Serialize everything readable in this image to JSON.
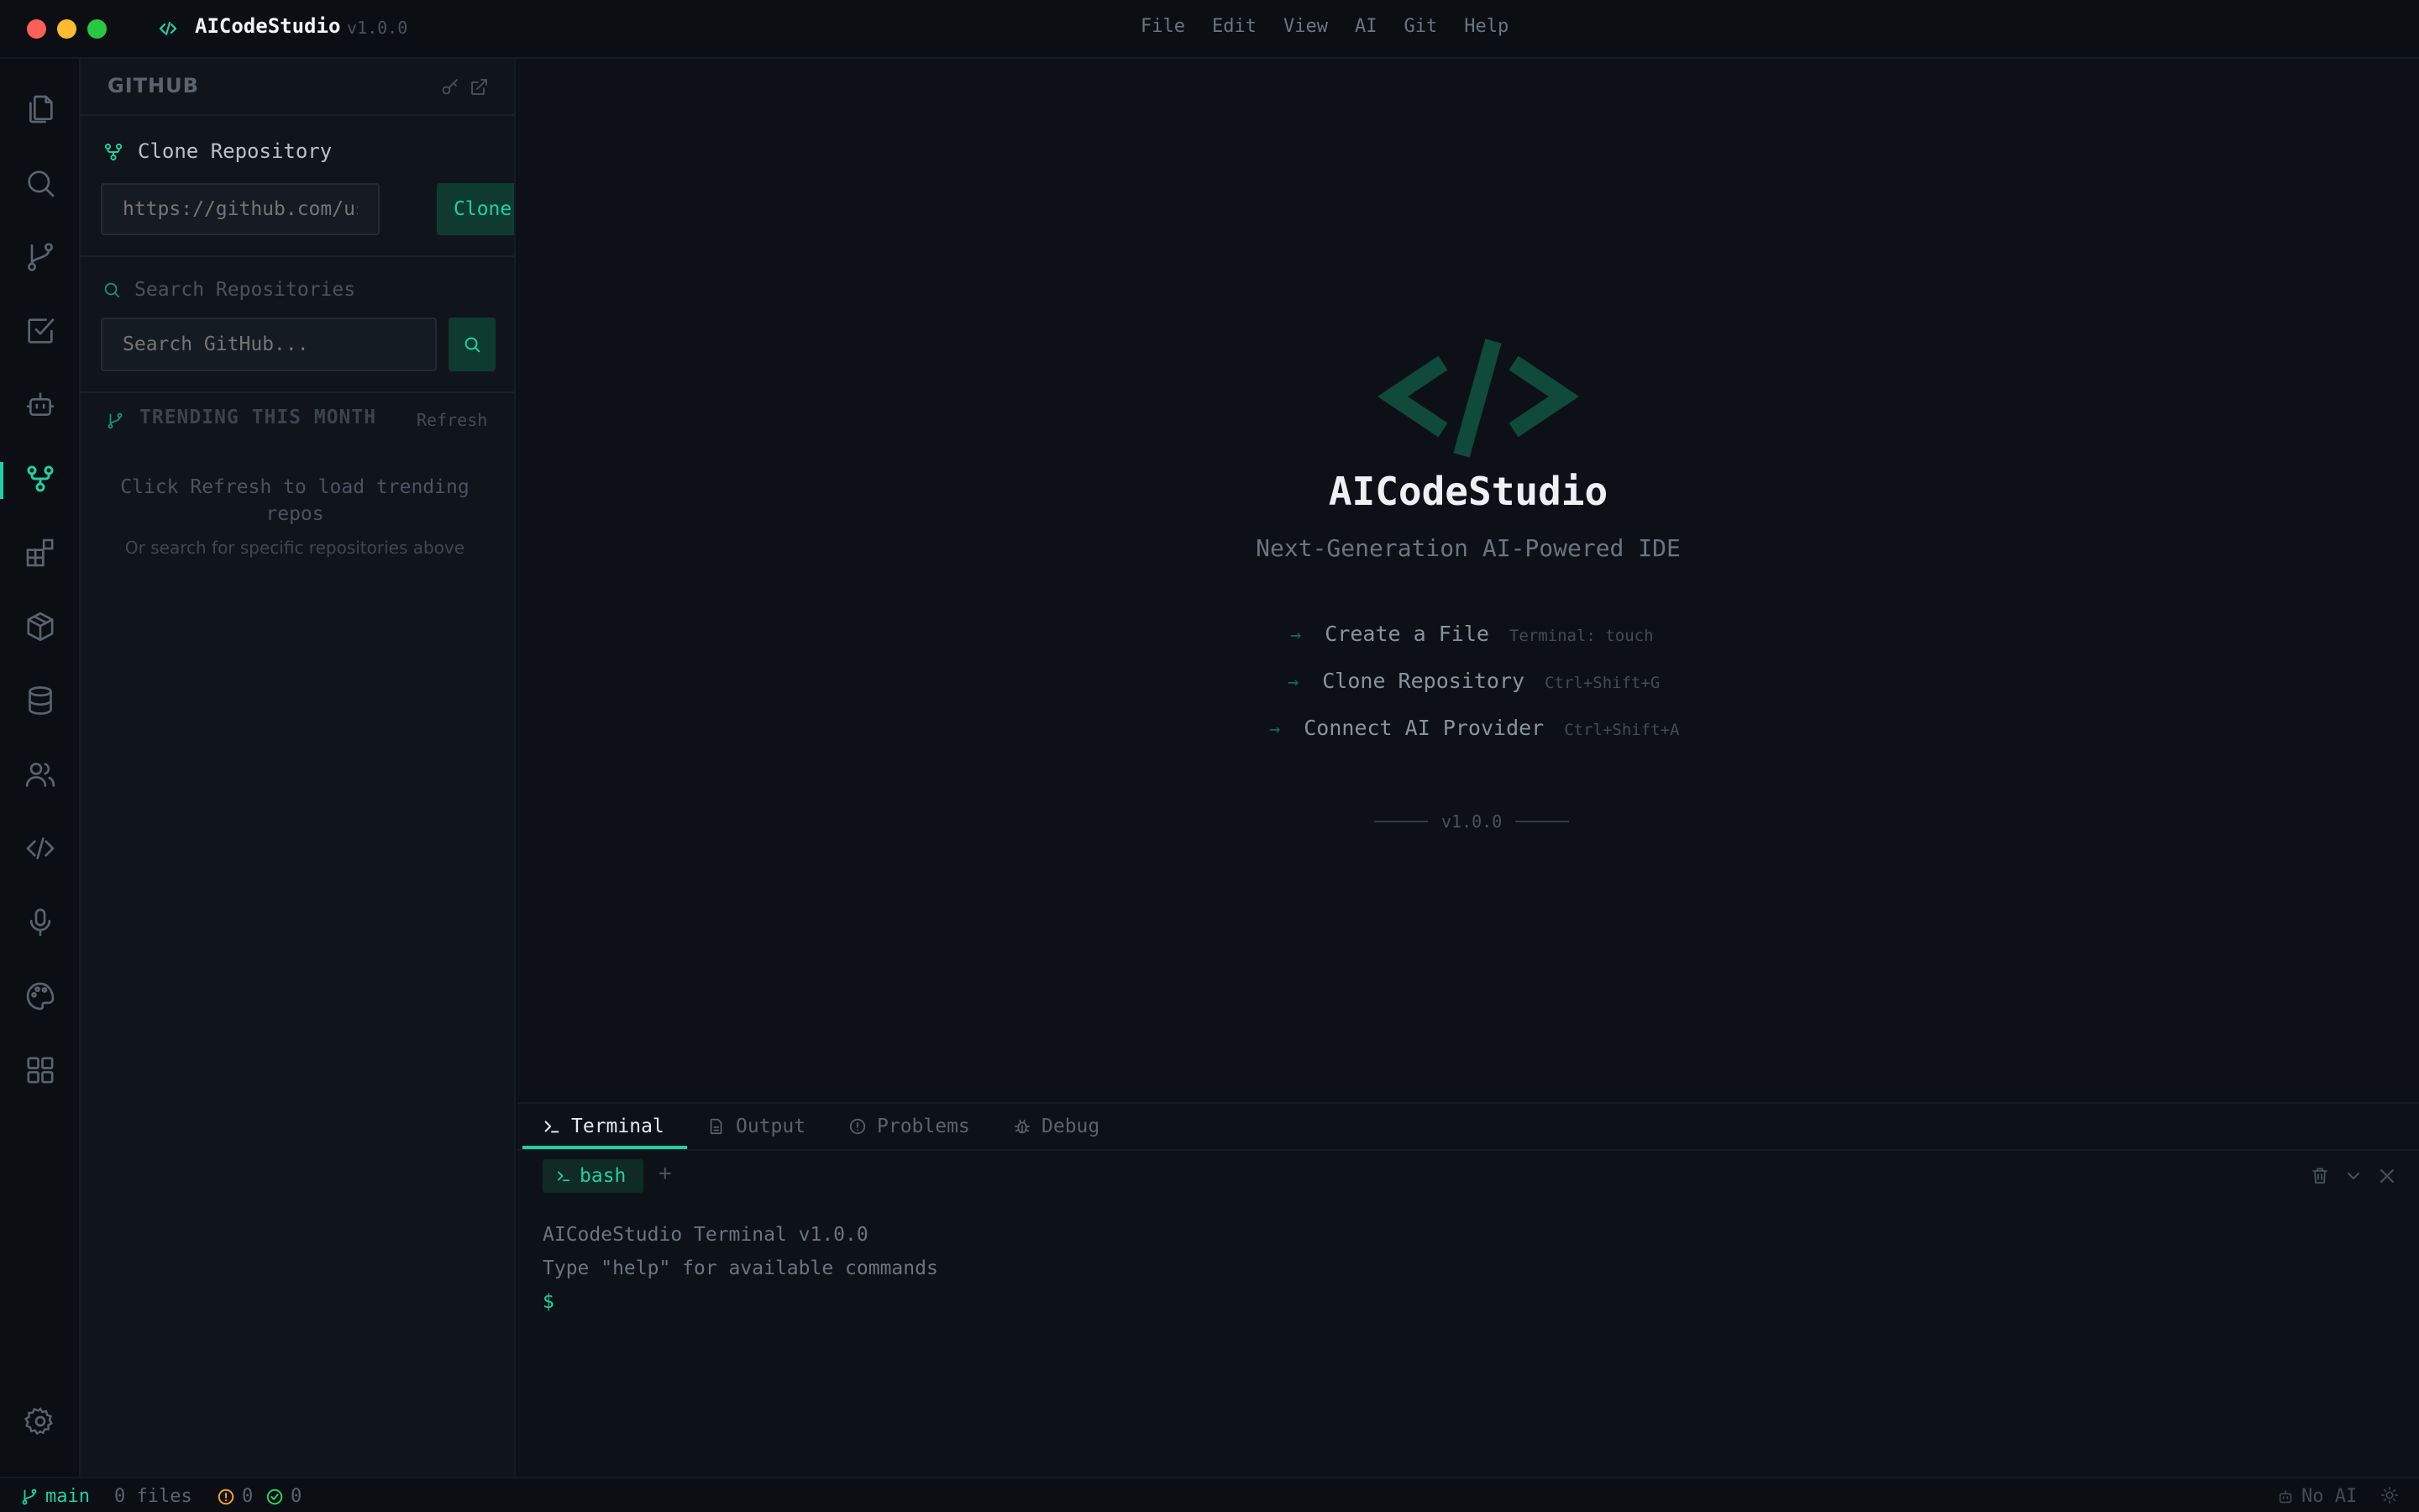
{
  "titlebar": {
    "app_name": "AICodeStudio",
    "version": "v1.0.0",
    "menu": [
      "File",
      "Edit",
      "View",
      "AI",
      "Git",
      "Help"
    ]
  },
  "activity_icons": [
    "files-icon",
    "search-icon",
    "source-control-icon",
    "tasks-icon",
    "robot-icon",
    "github-icon",
    "extensions-icon",
    "package-icon",
    "database-icon",
    "users-icon",
    "code-icon",
    "microphone-icon",
    "palette-icon",
    "grid-icon",
    "settings-icon"
  ],
  "sidebar": {
    "title": "GITHUB",
    "clone": {
      "title": "Clone Repository",
      "placeholder": "https://github.com/user/",
      "button": "Clone"
    },
    "search": {
      "title": "Search Repositories",
      "placeholder": "Search GitHub..."
    },
    "trending": {
      "title": "TRENDING THIS MONTH",
      "refresh": "Refresh",
      "message": "Click Refresh to load trending repos",
      "submessage": "Or search for specific repositories above"
    }
  },
  "welcome": {
    "title": "AICodeStudio",
    "subtitle": "Next-Generation AI-Powered IDE",
    "actions": [
      {
        "arrow": "→",
        "label": "Create a File",
        "shortcut": "Terminal: touch"
      },
      {
        "arrow": "→",
        "label": "Clone Repository",
        "shortcut": "Ctrl+Shift+G"
      },
      {
        "arrow": "→",
        "label": "Connect AI Provider",
        "shortcut": "Ctrl+Shift+A"
      }
    ],
    "version": "v1.0.0"
  },
  "panel": {
    "tabs": [
      "Terminal",
      "Output",
      "Problems",
      "Debug"
    ],
    "bash_tab": "bash",
    "add": "+",
    "lines": [
      "AICodeStudio Terminal v1.0.0",
      "Type \"help\" for available commands"
    ],
    "prompt": "$"
  },
  "statusbar": {
    "branch": "main",
    "files": "0 files",
    "errors": "0",
    "checks": "0",
    "ai_status": "No AI"
  },
  "colors": {
    "accent": "#1fd1a0",
    "background": "#0c1016",
    "close": "#fe5f57",
    "minimize": "#febc2e",
    "maximize": "#28c840"
  }
}
